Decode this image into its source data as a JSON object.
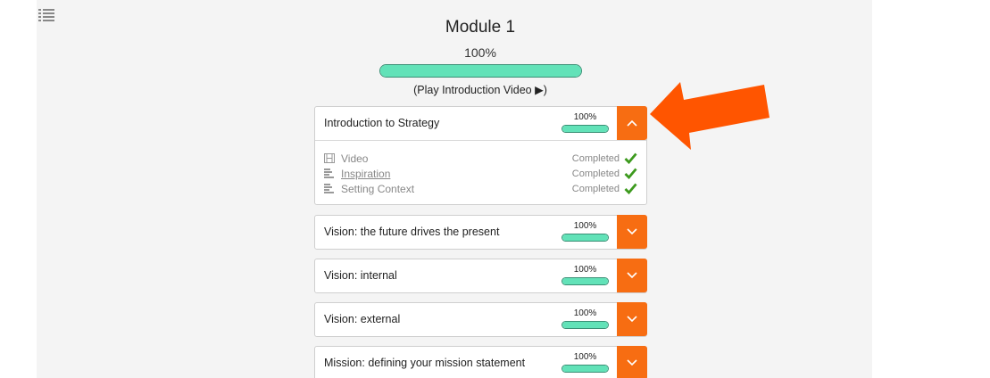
{
  "header": {
    "menu_icon": "list-icon",
    "module_title": "Module 1",
    "module_progress_label": "100%",
    "module_progress": 1.0,
    "play_intro_label": "(Play Introduction Video ▶)"
  },
  "colors": {
    "accent_orange": "#f76d12",
    "progress_green": "#62e2b8",
    "check_green": "#3d9a1e",
    "arrow_orange": "#ff5500"
  },
  "sections": [
    {
      "title": "Introduction to Strategy",
      "progress_label": "100%",
      "progress": 1.0,
      "expanded": true,
      "toggle_icon": "chevron-up-icon",
      "lessons": [
        {
          "icon": "film-icon",
          "name": "Video",
          "status": "Completed",
          "link": false
        },
        {
          "icon": "text-lines-icon",
          "name": "Inspiration",
          "status": "Completed",
          "link": true
        },
        {
          "icon": "text-lines-icon",
          "name": "Setting Context",
          "status": "Completed",
          "link": false
        }
      ]
    },
    {
      "title": "Vision: the future drives the present",
      "progress_label": "100%",
      "progress": 1.0,
      "expanded": false,
      "toggle_icon": "chevron-down-icon"
    },
    {
      "title": "Vision: internal",
      "progress_label": "100%",
      "progress": 1.0,
      "expanded": false,
      "toggle_icon": "chevron-down-icon"
    },
    {
      "title": "Vision: external",
      "progress_label": "100%",
      "progress": 1.0,
      "expanded": false,
      "toggle_icon": "chevron-down-icon"
    },
    {
      "title": "Mission: defining your mission statement",
      "progress_label": "100%",
      "progress": 1.0,
      "expanded": false,
      "toggle_icon": "chevron-down-icon"
    }
  ],
  "annotation": {
    "arrow_icon": "arrow-pointer-icon"
  }
}
